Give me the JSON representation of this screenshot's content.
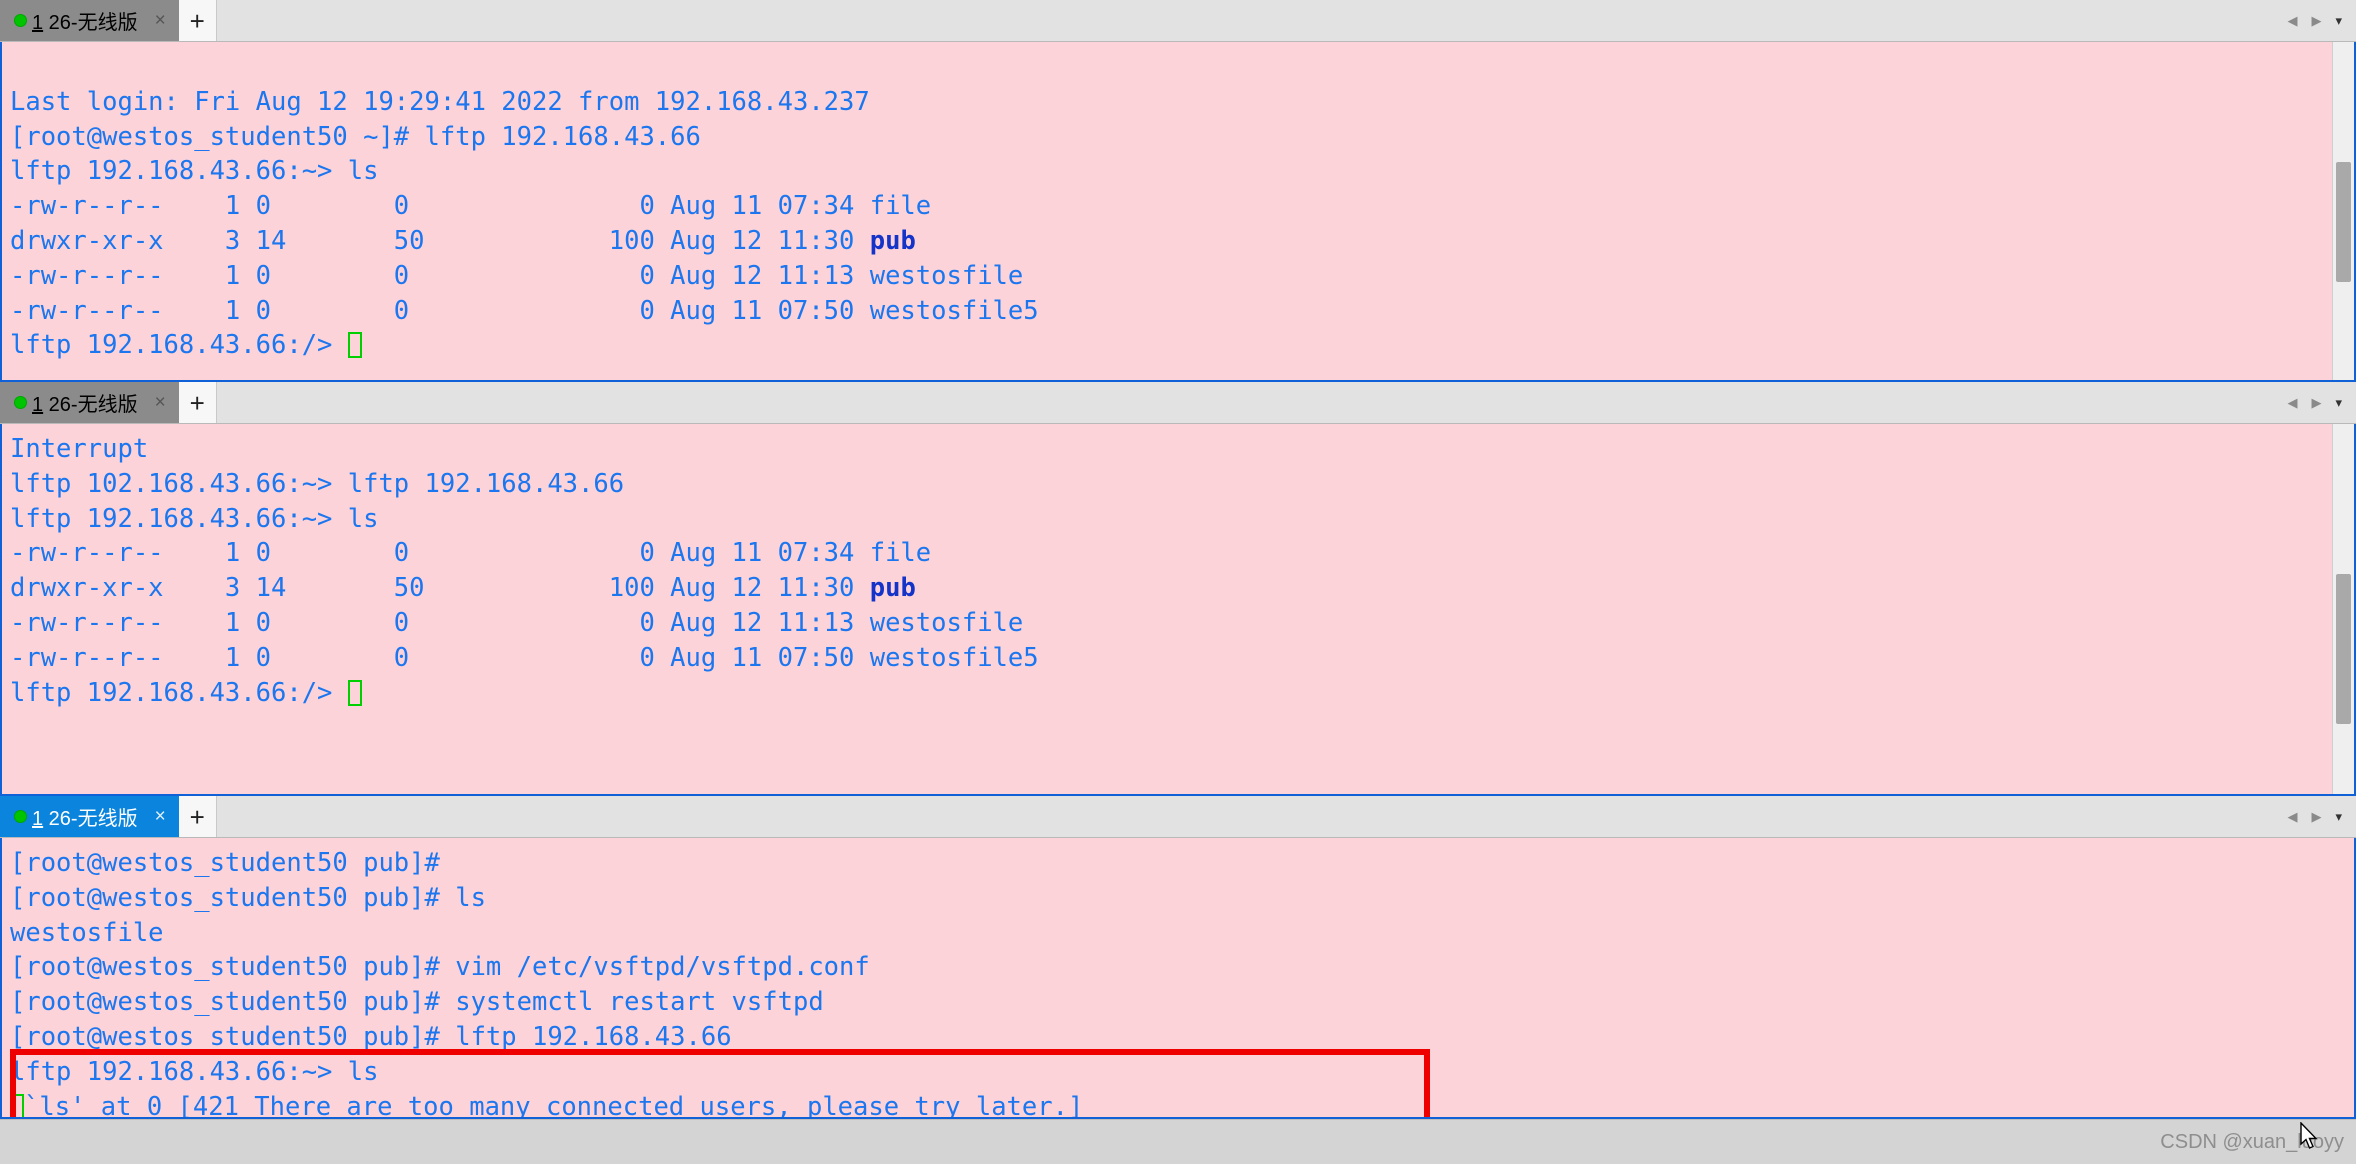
{
  "tabs": {
    "dot_color": "#00c400",
    "number": "1",
    "title": " 26-无线版",
    "close_label": "×",
    "newtab_label": "+",
    "prev_label": "◀",
    "next_label": "▶",
    "menu_label": "▾"
  },
  "terminals": [
    {
      "id": "terminal-pane-1",
      "tab_active": false,
      "lines": [
        {
          "text": ""
        },
        {
          "text": "Last login: Fri Aug 12 19:29:41 2022 from 192.168.43.237"
        },
        {
          "text": "[root@westos_student50 ~]# lftp 192.168.43.66"
        },
        {
          "text": "lftp 192.168.43.66:~> ls"
        },
        {
          "text": "-rw-r--r--    1 0        0               0 Aug 11 07:34 file"
        },
        {
          "text": "drwxr-xr-x    3 14       50            100 Aug 12 11:30 ",
          "dir": "pub"
        },
        {
          "text": "-rw-r--r--    1 0        0               0 Aug 12 11:13 westosfile"
        },
        {
          "text": "-rw-r--r--    1 0        0               0 Aug 11 07:50 westosfile5"
        },
        {
          "text": "lftp 192.168.43.66:/> ",
          "cursor": true
        }
      ]
    },
    {
      "id": "terminal-pane-2",
      "tab_active": false,
      "lines": [
        {
          "text": "Interrupt"
        },
        {
          "text": "lftp 102.168.43.66:~> lftp 192.168.43.66"
        },
        {
          "text": "lftp 192.168.43.66:~> ls"
        },
        {
          "text": "-rw-r--r--    1 0        0               0 Aug 11 07:34 file"
        },
        {
          "text": "drwxr-xr-x    3 14       50            100 Aug 12 11:30 ",
          "dir": "pub"
        },
        {
          "text": "-rw-r--r--    1 0        0               0 Aug 12 11:13 westosfile"
        },
        {
          "text": "-rw-r--r--    1 0        0               0 Aug 11 07:50 westosfile5"
        },
        {
          "text": "lftp 192.168.43.66:/> ",
          "cursor": true
        }
      ]
    },
    {
      "id": "terminal-pane-3",
      "tab_active": true,
      "lines": [
        {
          "text": "[root@westos_student50 pub]#"
        },
        {
          "text": "[root@westos_student50 pub]# ls"
        },
        {
          "text": "westosfile"
        },
        {
          "text": "[root@westos_student50 pub]# vim /etc/vsftpd/vsftpd.conf"
        },
        {
          "text": "[root@westos_student50 pub]# systemctl restart vsftpd"
        },
        {
          "text": "[root@westos_student50 pub]# lftp 192.168.43.66"
        },
        {
          "text": "lftp 192.168.43.66:~> ls"
        },
        {
          "text": "`ls' at 0 [421 There are too many connected users, please try later.]",
          "cursor_before": true
        }
      ]
    }
  ],
  "annotation": {
    "shape": "rectangle",
    "color": "#ee0000",
    "highlights_lines": [
      "lftp 192.168.43.66:~> ls",
      "`ls' at 0 [421 There are too many connected users, please try later.]"
    ]
  },
  "status": {
    "watermark": "CSDN @xuan_luoyy"
  },
  "colors": {
    "terminal_bg": "#fbd3d8",
    "terminal_fg": "#1b76ef",
    "dir_fg": "#1433c8",
    "pane_border": "#1060d8",
    "tab_active_bg": "#0a84dd",
    "tab_inactive_bg": "#8b8b8b",
    "cursor": "#00d000"
  }
}
